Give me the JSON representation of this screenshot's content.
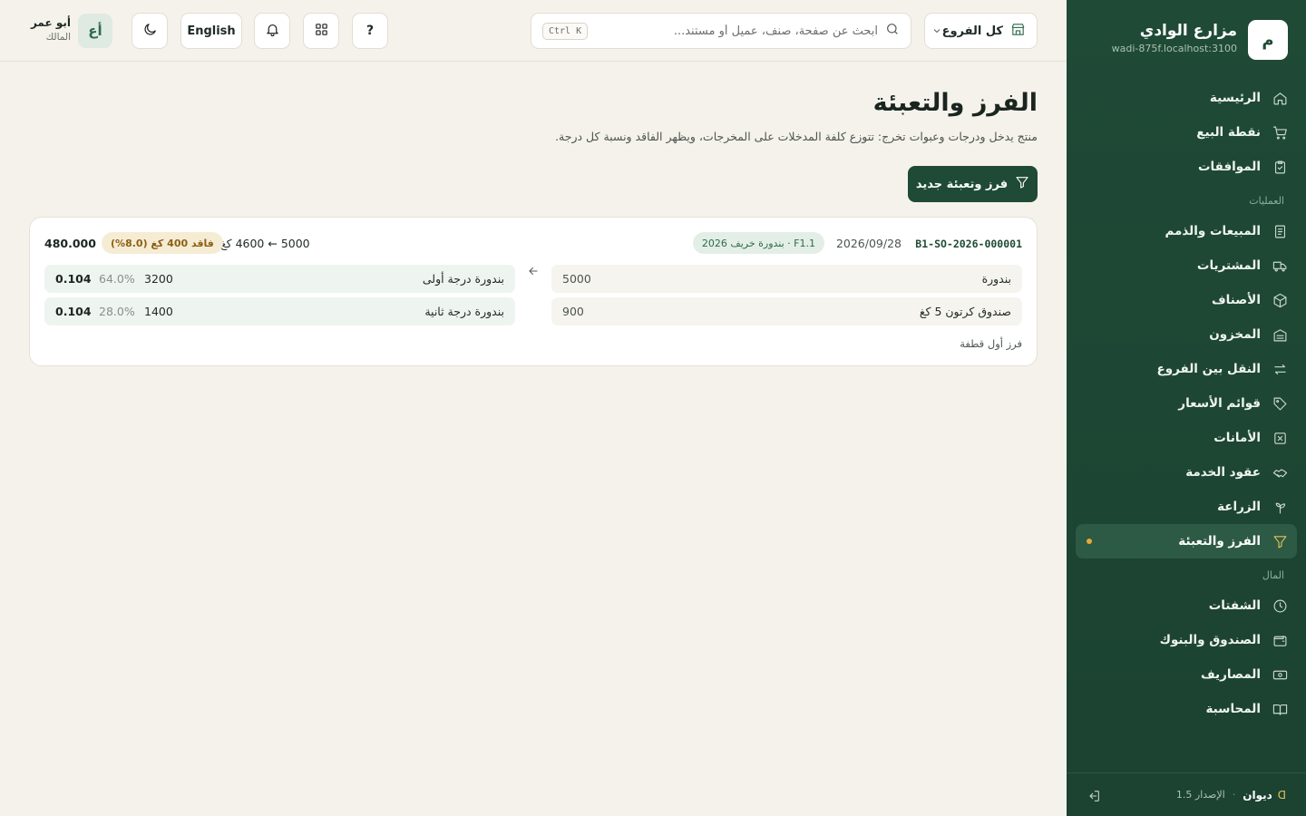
{
  "sidebar": {
    "brand_initial": "م",
    "brand_name": "مزارع الوادي",
    "brand_host": "wadi-875f.localhost:3100",
    "items": [
      {
        "label": "الرئيسية",
        "icon": "home-icon"
      },
      {
        "label": "نقطة البيع",
        "icon": "cart-icon"
      },
      {
        "label": "الموافقات",
        "icon": "clipboard-check-icon"
      }
    ],
    "section_operations": "العمليات",
    "operations": [
      {
        "label": "المبيعات والذمم",
        "icon": "receipt-icon"
      },
      {
        "label": "المشتريات",
        "icon": "truck-icon"
      },
      {
        "label": "الأصناف",
        "icon": "box-icon"
      },
      {
        "label": "المخزون",
        "icon": "warehouse-icon"
      },
      {
        "label": "النقل بين الفروع",
        "icon": "transfer-icon"
      },
      {
        "label": "قوائم الأسعار",
        "icon": "tag-icon"
      },
      {
        "label": "الأمانات",
        "icon": "x-box-icon"
      },
      {
        "label": "عقود الخدمة",
        "icon": "handshake-icon"
      },
      {
        "label": "الزراعة",
        "icon": "sprout-icon"
      },
      {
        "label": "الفرز والتعبئة",
        "icon": "filter-icon",
        "active": true
      }
    ],
    "section_finance": "المال",
    "finance": [
      {
        "label": "الشفتات",
        "icon": "clock-icon"
      },
      {
        "label": "الصندوق والبنوك",
        "icon": "wallet-icon"
      },
      {
        "label": "المصاريف",
        "icon": "banknote-icon"
      },
      {
        "label": "المحاسبة",
        "icon": "book-icon"
      }
    ],
    "footer": {
      "logo": "ᗡ",
      "name": "ديوان",
      "sep": "·",
      "version": "الإصدار 1.5"
    }
  },
  "topbar": {
    "branch_label": "كل الفروع",
    "search_placeholder": "ابحث عن صفحة، صنف، عميل أو مستند...",
    "search_shortcut": "Ctrl K",
    "help_label": "?",
    "language_label": "English",
    "avatar_initials": "أع",
    "user_name": "أبو عمر",
    "user_role": "المالك"
  },
  "main": {
    "title": "الفرز والتعبئة",
    "subtitle": "منتج يدخل ودرجات وعبوات تخرج: تتوزع كلفة المدخلات على المخرجات، ويظهر الفاقد ونسبة كل درجة.",
    "new_button": "فرز وتعبئة جديد",
    "card": {
      "ref": "B1-SO-2026-000001",
      "date": "2026/09/28",
      "batch_badge": "F1.1 · بندورة خريف 2026",
      "flow": "5000 ← 4600 كغ",
      "loss_badge": "فاقد 400 كغ (8.0%)",
      "total": "480.000",
      "inputs": [
        {
          "name": "بندورة",
          "qty": "5000"
        },
        {
          "name": "صندوق كرتون 5 كغ",
          "qty": "900"
        }
      ],
      "outputs": [
        {
          "name": "بندورة درجة أولى",
          "qty": "3200",
          "pct": "64.0%",
          "unit_cost": "0.104"
        },
        {
          "name": "بندورة درجة ثانية",
          "qty": "1400",
          "pct": "28.0%",
          "unit_cost": "0.104"
        }
      ],
      "note": "فرز أول قطفة"
    }
  }
}
